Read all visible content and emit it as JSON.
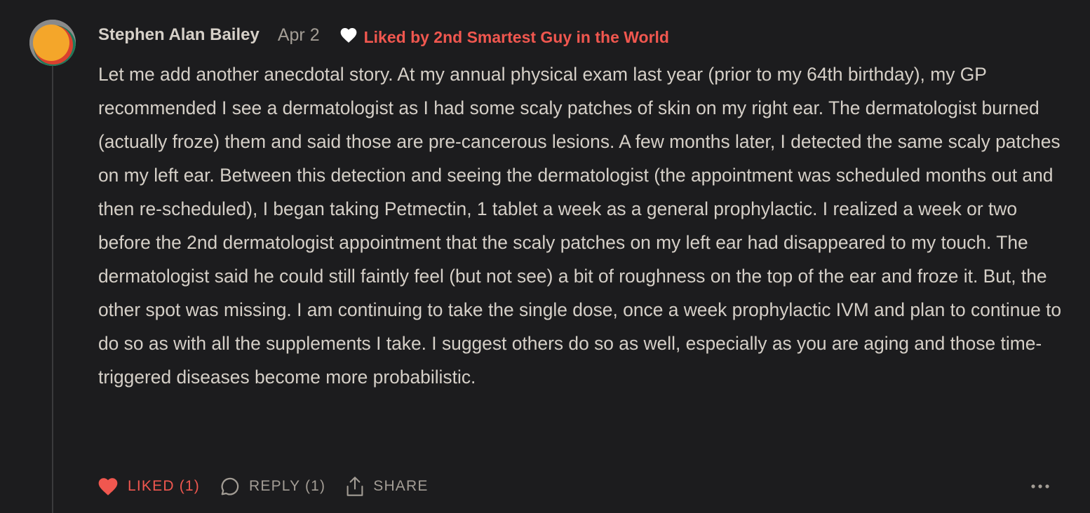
{
  "comment": {
    "author": "Stephen Alan Bailey",
    "date": "Apr 2",
    "liked_by_text": "Liked by 2nd Smartest Guy in the World",
    "body": "Let me add another anecdotal story. At my annual physical exam last year (prior to my 64th birthday), my GP recommended I see a dermatologist as I had some scaly patches of skin on my right ear. The dermatologist burned (actually froze) them and said those are pre-cancerous lesions. A few months later, I detected the same scaly patches on my left ear. Between this detection and seeing the dermatologist (the appointment was scheduled months out and then re-scheduled), I began taking Petmectin, 1 tablet a week as a general prophylactic. I realized a week or two before the 2nd dermatologist appointment that the scaly patches on my left ear had disappeared to my touch. The dermatologist said he could still faintly feel (but not see) a bit of roughness on the top of the ear and froze it. But, the other spot was missing. I am continuing to take the single dose, once a week prophylactic IVM and plan to continue to do so as with all the supplements I take. I suggest others do so as well, especially as you are aging and those time-triggered diseases become more probabilistic."
  },
  "actions": {
    "like_label": "LIKED (1)",
    "reply_label": "REPLY (1)",
    "share_label": "SHARE",
    "more_icon": "more-horizontal-icon"
  },
  "colors": {
    "background": "#1c1c1e",
    "text": "#d5cfc7",
    "muted": "#a39d95",
    "accent_red": "#f0574f",
    "avatar_orange": "#f4a62a",
    "avatar_green": "#1f7a5a",
    "avatar_red": "#d9402f"
  }
}
